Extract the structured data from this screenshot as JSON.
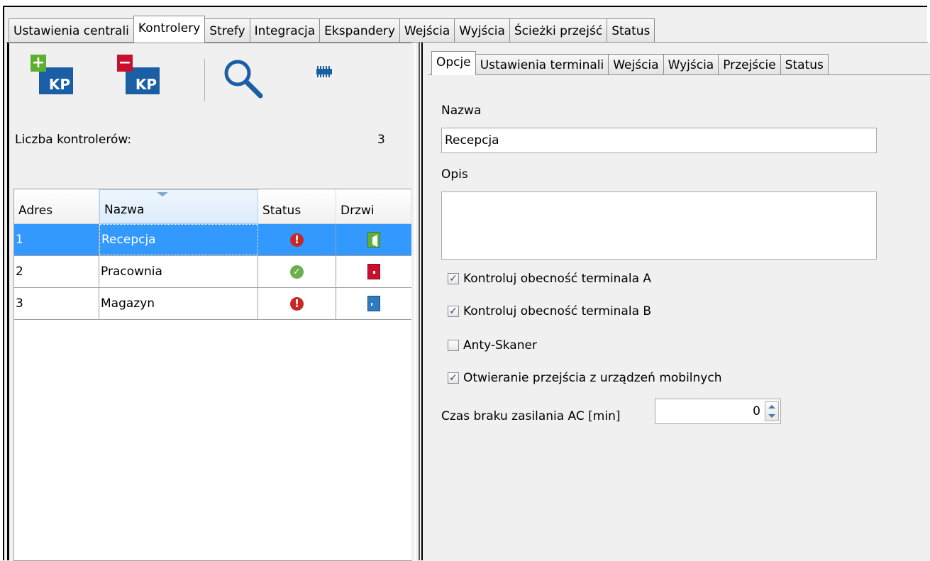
{
  "top_tabs": [
    {
      "label": "Ustawienia centrali",
      "active": false
    },
    {
      "label": "Kontrolery",
      "active": true
    },
    {
      "label": "Strefy",
      "active": false
    },
    {
      "label": "Integracja",
      "active": false
    },
    {
      "label": "Ekspandery",
      "active": false
    },
    {
      "label": "Wejścia",
      "active": false
    },
    {
      "label": "Wyjścia",
      "active": false
    },
    {
      "label": "Ścieżki przejść",
      "active": false
    },
    {
      "label": "Status",
      "active": false
    }
  ],
  "toolbar": {
    "add_icon": "add-keypad-icon",
    "add_text": "KP",
    "add_sign": "+",
    "remove_icon": "remove-keypad-icon",
    "remove_text": "KP",
    "remove_sign": "−",
    "search_icon": "search-icon",
    "module_icon": "controller-module-icon"
  },
  "controllers": {
    "count_label": "Liczba kontrolerów:",
    "count_value": "3",
    "columns": [
      "Adres",
      "Nazwa",
      "Status",
      "Drzwi"
    ],
    "rows": [
      {
        "address": "1",
        "name": "Recepcja",
        "status": "error",
        "door": "open",
        "selected": true
      },
      {
        "address": "2",
        "name": "Pracownia",
        "status": "ok",
        "door": "locked",
        "selected": false
      },
      {
        "address": "3",
        "name": "Magazyn",
        "status": "error",
        "door": "closed",
        "selected": false
      }
    ]
  },
  "detail": {
    "tabs": [
      {
        "label": "Opcje",
        "active": true
      },
      {
        "label": "Ustawienia terminali",
        "active": false
      },
      {
        "label": "Wejścia",
        "active": false
      },
      {
        "label": "Wyjścia",
        "active": false
      },
      {
        "label": "Przejście",
        "active": false
      },
      {
        "label": "Status",
        "active": false
      }
    ],
    "name_label": "Nazwa",
    "name_value": "Recepcja",
    "description_label": "Opis",
    "description_value": "",
    "checkboxes": [
      {
        "label": "Kontroluj obecność terminala A",
        "checked": true
      },
      {
        "label": "Kontroluj obecność terminala B",
        "checked": true
      },
      {
        "label": "Anty-Skaner",
        "checked": false
      },
      {
        "label": "Otwieranie przejścia z urządzeń mobilnych",
        "checked": true
      }
    ],
    "ac_label": "Czas braku zasilania AC [min]",
    "ac_value": "0"
  },
  "colors": {
    "selection": "#3399ff",
    "error": "#c62828",
    "ok": "#6ab04c",
    "kp_blue": "#1a5fa6"
  }
}
